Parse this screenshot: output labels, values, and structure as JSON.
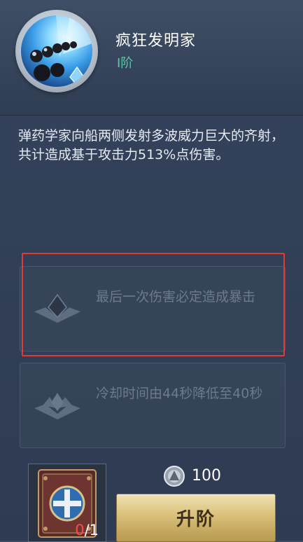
{
  "skill": {
    "name": "疯狂发明家",
    "tier": "I阶",
    "description": "弹药学家向船两侧发射多波威力巨大的齐射，共计造成基于攻击力513%点伤害。",
    "icon": "cannon-volley-icon"
  },
  "upgrades": [
    {
      "text": "最后一次伤害必定造成暴击",
      "icon": "rank-emblem-icon",
      "highlighted": true
    },
    {
      "text": "冷却时间由44秒降低至40秒",
      "icon": "rank-emblem-icon",
      "highlighted": false
    }
  ],
  "material": {
    "icon": "skill-book-icon",
    "count_have": "0",
    "count_need": "/1"
  },
  "cost": {
    "icon": "silver-coin-icon",
    "value": "100"
  },
  "upgrade_button": {
    "label": "升阶"
  },
  "colors": {
    "tier": "#5cc7a6",
    "highlight": "#e53935",
    "count_zero": "#ff4a4a",
    "button_gold": "#d9c07a"
  }
}
